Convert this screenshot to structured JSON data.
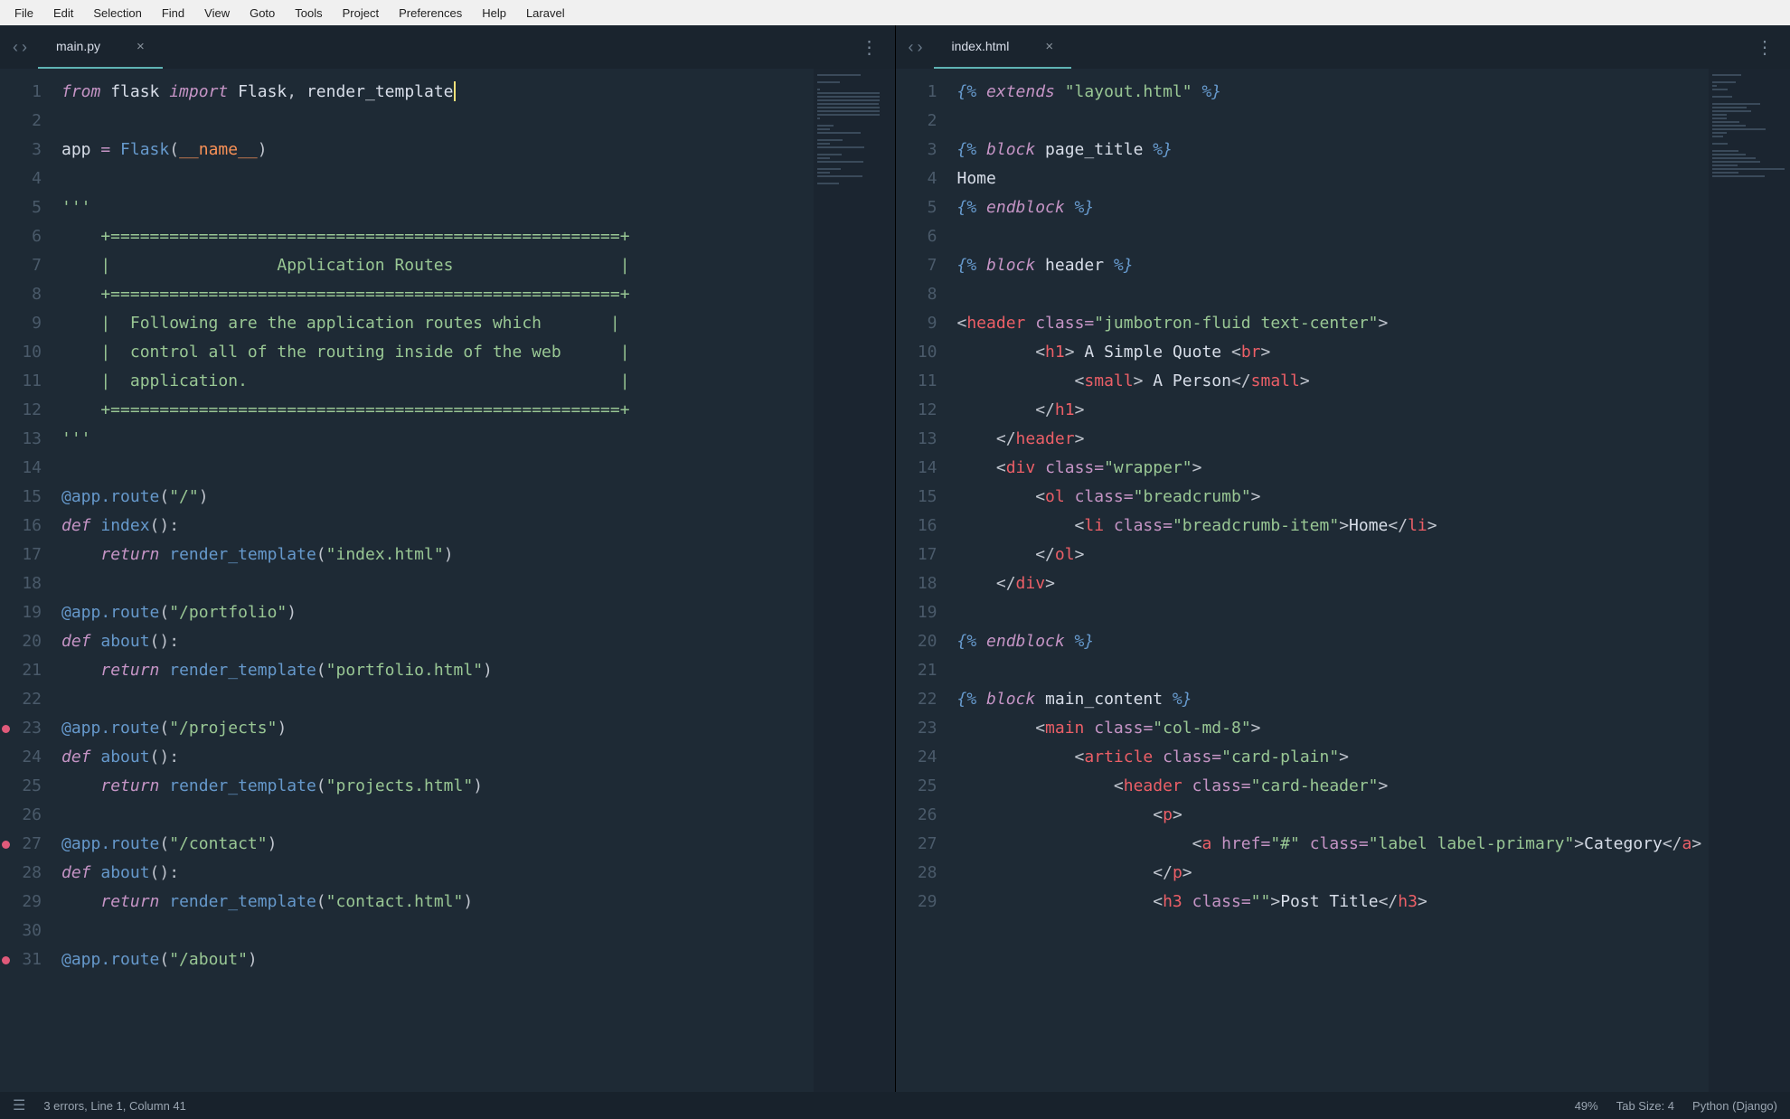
{
  "menubar": [
    "File",
    "Edit",
    "Selection",
    "Find",
    "View",
    "Goto",
    "Tools",
    "Project",
    "Preferences",
    "Help",
    "Laravel"
  ],
  "left": {
    "tab": "main.py",
    "lines_start": 1,
    "lines_end": 31,
    "breakpoints": [
      23,
      27,
      31
    ],
    "code": [
      [
        [
          "kw-it",
          "from"
        ],
        [
          "txt",
          " flask "
        ],
        [
          "kw-it",
          "import"
        ],
        [
          "txt",
          " Flask"
        ],
        [
          "pun",
          ","
        ],
        [
          "txt",
          " render_template"
        ],
        [
          "cursor",
          ""
        ]
      ],
      [],
      [
        [
          "txt",
          "app "
        ],
        [
          "op",
          "="
        ],
        [
          "txt",
          " "
        ],
        [
          "fn",
          "Flask"
        ],
        [
          "pun",
          "("
        ],
        [
          "param",
          "__name__"
        ],
        [
          "pun",
          ")"
        ]
      ],
      [],
      [
        [
          "str",
          "'''"
        ]
      ],
      [
        [
          "str",
          "    +====================================================+"
        ]
      ],
      [
        [
          "str",
          "    |                 Application Routes                 |"
        ]
      ],
      [
        [
          "str",
          "    +====================================================+"
        ]
      ],
      [
        [
          "str",
          "    |  Following are the application routes which       |"
        ]
      ],
      [
        [
          "str",
          "    |  control all of the routing inside of the web      |"
        ]
      ],
      [
        [
          "str",
          "    |  application.                                      |"
        ]
      ],
      [
        [
          "str",
          "    +====================================================+"
        ]
      ],
      [
        [
          "str",
          "'''"
        ]
      ],
      [],
      [
        [
          "fn",
          "@app.route"
        ],
        [
          "pun",
          "("
        ],
        [
          "str",
          "\"/\""
        ],
        [
          "pun",
          ")"
        ]
      ],
      [
        [
          "kw-it",
          "def"
        ],
        [
          "txt",
          " "
        ],
        [
          "fn",
          "index"
        ],
        [
          "pun",
          "():"
        ]
      ],
      [
        [
          "txt",
          "    "
        ],
        [
          "kw-it",
          "return"
        ],
        [
          "txt",
          " "
        ],
        [
          "fn",
          "render_template"
        ],
        [
          "pun",
          "("
        ],
        [
          "str",
          "\"index.html\""
        ],
        [
          "pun",
          ")"
        ]
      ],
      [],
      [
        [
          "fn",
          "@app.route"
        ],
        [
          "pun",
          "("
        ],
        [
          "str",
          "\"/portfolio\""
        ],
        [
          "pun",
          ")"
        ]
      ],
      [
        [
          "kw-it",
          "def"
        ],
        [
          "txt",
          " "
        ],
        [
          "fn",
          "about"
        ],
        [
          "pun",
          "():"
        ]
      ],
      [
        [
          "txt",
          "    "
        ],
        [
          "kw-it",
          "return"
        ],
        [
          "txt",
          " "
        ],
        [
          "fn",
          "render_template"
        ],
        [
          "pun",
          "("
        ],
        [
          "str",
          "\"portfolio.html\""
        ],
        [
          "pun",
          ")"
        ]
      ],
      [],
      [
        [
          "fn",
          "@app.route"
        ],
        [
          "pun",
          "("
        ],
        [
          "str",
          "\"/projects\""
        ],
        [
          "pun",
          ")"
        ]
      ],
      [
        [
          "kw-it",
          "def"
        ],
        [
          "txt",
          " "
        ],
        [
          "fn",
          "about"
        ],
        [
          "pun",
          "():"
        ]
      ],
      [
        [
          "txt",
          "    "
        ],
        [
          "kw-it",
          "return"
        ],
        [
          "txt",
          " "
        ],
        [
          "fn",
          "render_template"
        ],
        [
          "pun",
          "("
        ],
        [
          "str",
          "\"projects.html\""
        ],
        [
          "pun",
          ")"
        ]
      ],
      [],
      [
        [
          "fn",
          "@app.route"
        ],
        [
          "pun",
          "("
        ],
        [
          "str",
          "\"/contact\""
        ],
        [
          "pun",
          ")"
        ]
      ],
      [
        [
          "kw-it",
          "def"
        ],
        [
          "txt",
          " "
        ],
        [
          "fn",
          "about"
        ],
        [
          "pun",
          "():"
        ]
      ],
      [
        [
          "txt",
          "    "
        ],
        [
          "kw-it",
          "return"
        ],
        [
          "txt",
          " "
        ],
        [
          "fn",
          "render_template"
        ],
        [
          "pun",
          "("
        ],
        [
          "str",
          "\"contact.html\""
        ],
        [
          "pun",
          ")"
        ]
      ],
      [],
      [
        [
          "fn",
          "@app.route"
        ],
        [
          "pun",
          "("
        ],
        [
          "str",
          "\"/about\""
        ],
        [
          "pun",
          ")"
        ]
      ]
    ]
  },
  "right": {
    "tab": "index.html",
    "lines_start": 1,
    "lines_end": 29,
    "breakpoints": [],
    "code": [
      [
        [
          "jblk",
          "{% "
        ],
        [
          "jkey",
          "extends"
        ],
        [
          "jblk",
          " "
        ],
        [
          "str",
          "\"layout.html\""
        ],
        [
          "jblk",
          " %}"
        ]
      ],
      [],
      [
        [
          "jblk",
          "{% "
        ],
        [
          "jkey",
          "block"
        ],
        [
          "jblk",
          " "
        ],
        [
          "jnm",
          "page_title"
        ],
        [
          "jblk",
          " %}"
        ]
      ],
      [
        [
          "txt",
          "Home"
        ]
      ],
      [
        [
          "jblk",
          "{% "
        ],
        [
          "jkey",
          "endblock"
        ],
        [
          "jblk",
          " %}"
        ]
      ],
      [],
      [
        [
          "jblk",
          "{% "
        ],
        [
          "jkey",
          "block"
        ],
        [
          "jblk",
          " "
        ],
        [
          "jnm",
          "header"
        ],
        [
          "jblk",
          " %}"
        ]
      ],
      [],
      [
        [
          "pun",
          "<"
        ],
        [
          "tag",
          "header"
        ],
        [
          "txt",
          " "
        ],
        [
          "attr",
          "class"
        ],
        [
          "op",
          "="
        ],
        [
          "str",
          "\"jumbotron-fluid text-center\""
        ],
        [
          "pun",
          ">"
        ]
      ],
      [
        [
          "txt",
          "        "
        ],
        [
          "pun",
          "<"
        ],
        [
          "tag",
          "h1"
        ],
        [
          "pun",
          ">"
        ],
        [
          "txt",
          " A Simple Quote "
        ],
        [
          "pun",
          "<"
        ],
        [
          "tag",
          "br"
        ],
        [
          "pun",
          ">"
        ]
      ],
      [
        [
          "txt",
          "            "
        ],
        [
          "pun",
          "<"
        ],
        [
          "tag",
          "small"
        ],
        [
          "pun",
          ">"
        ],
        [
          "txt",
          " A Person"
        ],
        [
          "pun",
          "</"
        ],
        [
          "tag",
          "small"
        ],
        [
          "pun",
          ">"
        ]
      ],
      [
        [
          "txt",
          "        "
        ],
        [
          "pun",
          "</"
        ],
        [
          "tag",
          "h1"
        ],
        [
          "pun",
          ">"
        ]
      ],
      [
        [
          "txt",
          "    "
        ],
        [
          "pun",
          "</"
        ],
        [
          "tag",
          "header"
        ],
        [
          "pun",
          ">"
        ]
      ],
      [
        [
          "txt",
          "    "
        ],
        [
          "pun",
          "<"
        ],
        [
          "tag",
          "div"
        ],
        [
          "txt",
          " "
        ],
        [
          "attr",
          "class"
        ],
        [
          "op",
          "="
        ],
        [
          "str",
          "\"wrapper\""
        ],
        [
          "pun",
          ">"
        ]
      ],
      [
        [
          "txt",
          "        "
        ],
        [
          "pun",
          "<"
        ],
        [
          "tag",
          "ol"
        ],
        [
          "txt",
          " "
        ],
        [
          "attr",
          "class"
        ],
        [
          "op",
          "="
        ],
        [
          "str",
          "\"breadcrumb\""
        ],
        [
          "pun",
          ">"
        ]
      ],
      [
        [
          "txt",
          "            "
        ],
        [
          "pun",
          "<"
        ],
        [
          "tag",
          "li"
        ],
        [
          "txt",
          " "
        ],
        [
          "attr",
          "class"
        ],
        [
          "op",
          "="
        ],
        [
          "str",
          "\"breadcrumb-item\""
        ],
        [
          "pun",
          ">"
        ],
        [
          "txt",
          "Home"
        ],
        [
          "pun",
          "</"
        ],
        [
          "tag",
          "li"
        ],
        [
          "pun",
          ">"
        ]
      ],
      [
        [
          "txt",
          "        "
        ],
        [
          "pun",
          "</"
        ],
        [
          "tag",
          "ol"
        ],
        [
          "pun",
          ">"
        ]
      ],
      [
        [
          "txt",
          "    "
        ],
        [
          "pun",
          "</"
        ],
        [
          "tag",
          "div"
        ],
        [
          "pun",
          ">"
        ]
      ],
      [],
      [
        [
          "jblk",
          "{% "
        ],
        [
          "jkey",
          "endblock"
        ],
        [
          "jblk",
          " %}"
        ]
      ],
      [],
      [
        [
          "jblk",
          "{% "
        ],
        [
          "jkey",
          "block"
        ],
        [
          "jblk",
          " "
        ],
        [
          "jnm",
          "main_content"
        ],
        [
          "jblk",
          " %}"
        ]
      ],
      [
        [
          "txt",
          "        "
        ],
        [
          "pun",
          "<"
        ],
        [
          "tag",
          "main"
        ],
        [
          "txt",
          " "
        ],
        [
          "attr",
          "class"
        ],
        [
          "op",
          "="
        ],
        [
          "str",
          "\"col-md-8\""
        ],
        [
          "pun",
          ">"
        ]
      ],
      [
        [
          "txt",
          "            "
        ],
        [
          "pun",
          "<"
        ],
        [
          "tag",
          "article"
        ],
        [
          "txt",
          " "
        ],
        [
          "attr",
          "class"
        ],
        [
          "op",
          "="
        ],
        [
          "str",
          "\"card-plain\""
        ],
        [
          "pun",
          ">"
        ]
      ],
      [
        [
          "txt",
          "                "
        ],
        [
          "pun",
          "<"
        ],
        [
          "tag",
          "header"
        ],
        [
          "txt",
          " "
        ],
        [
          "attr",
          "class"
        ],
        [
          "op",
          "="
        ],
        [
          "str",
          "\"card-header\""
        ],
        [
          "pun",
          ">"
        ]
      ],
      [
        [
          "txt",
          "                    "
        ],
        [
          "pun",
          "<"
        ],
        [
          "tag",
          "p"
        ],
        [
          "pun",
          ">"
        ]
      ],
      [
        [
          "txt",
          "                        "
        ],
        [
          "pun",
          "<"
        ],
        [
          "tag",
          "a"
        ],
        [
          "txt",
          " "
        ],
        [
          "attr",
          "href"
        ],
        [
          "op",
          "="
        ],
        [
          "str",
          "\"#\""
        ],
        [
          "txt",
          " "
        ],
        [
          "attr",
          "class"
        ],
        [
          "op",
          "="
        ],
        [
          "str",
          "\"label label-primary\""
        ],
        [
          "pun",
          ">"
        ],
        [
          "txt",
          "Category"
        ],
        [
          "pun",
          "</"
        ],
        [
          "tag",
          "a"
        ],
        [
          "pun",
          ">"
        ]
      ],
      [
        [
          "txt",
          "                    "
        ],
        [
          "pun",
          "</"
        ],
        [
          "tag",
          "p"
        ],
        [
          "pun",
          ">"
        ]
      ],
      [
        [
          "txt",
          "                    "
        ],
        [
          "pun",
          "<"
        ],
        [
          "tag",
          "h3"
        ],
        [
          "txt",
          " "
        ],
        [
          "attr",
          "class"
        ],
        [
          "op",
          "="
        ],
        [
          "str",
          "\"\""
        ],
        [
          "pun",
          ">"
        ],
        [
          "txt",
          "Post Title"
        ],
        [
          "pun",
          "</"
        ],
        [
          "tag",
          "h3"
        ],
        [
          "pun",
          ">"
        ]
      ]
    ]
  },
  "status": {
    "left": "3 errors, Line 1, Column 41",
    "zoom": "49%",
    "tab_size": "Tab Size: 4",
    "syntax": "Python (Django)"
  }
}
